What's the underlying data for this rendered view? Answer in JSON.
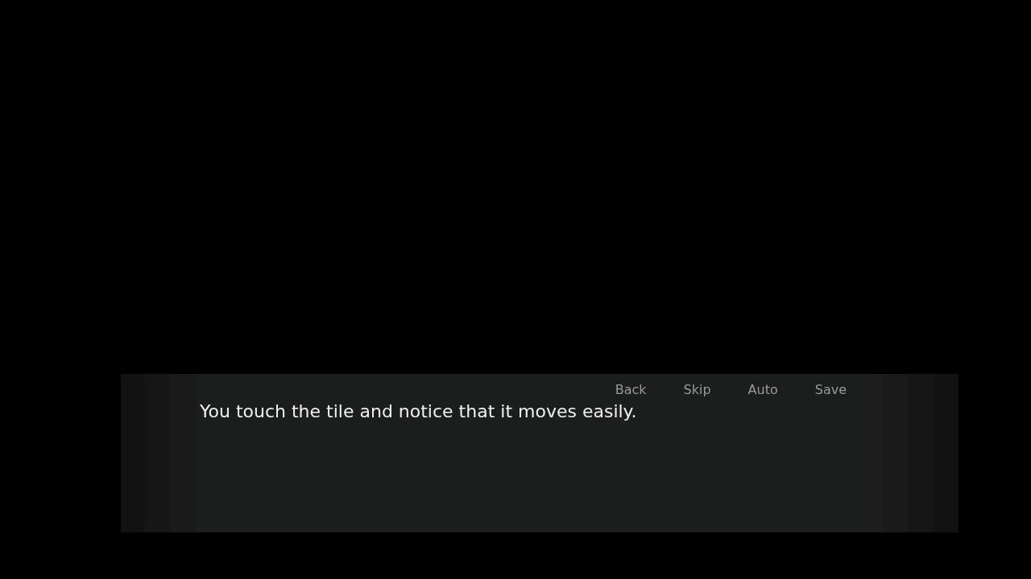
{
  "quick_menu": [
    {
      "label": "Back"
    },
    {
      "label": "Skip"
    },
    {
      "label": "Auto"
    },
    {
      "label": "Save"
    }
  ],
  "dialogue": {
    "text": "You touch the tile and notice that it moves easily."
  }
}
